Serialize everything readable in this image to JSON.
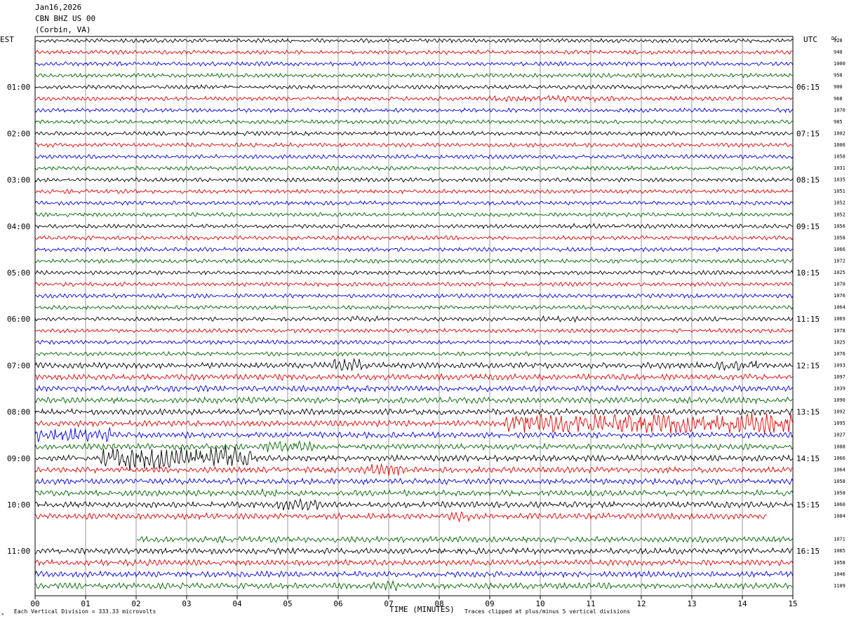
{
  "header": {
    "date": "Jan16,2026",
    "station": "CBN BHZ US 00",
    "location": "(Corbin, VA)"
  },
  "left_timezone": "EST",
  "right_timezone": "UTC",
  "dc_label": "DC",
  "footer": {
    "scale_note": "Each Vertical Division =  333.33 microvolts",
    "xlabel": "TIME (MINUTES)",
    "clip_note": "Traces clipped at plus/minus 5 vertical divisions"
  },
  "colors": {
    "traces": [
      "#000000",
      "#e00000",
      "#0000e0",
      "#006400"
    ],
    "grid": "#808080"
  },
  "chart_data": {
    "type": "line",
    "title": "Jan16,2026 CBN BHZ US 00 (Corbin, VA)",
    "xlabel": "TIME (MINUTES)",
    "xlim": [
      0,
      15
    ],
    "x_ticks": [
      "00",
      "01",
      "02",
      "03",
      "04",
      "05",
      "06",
      "07",
      "08",
      "09",
      "10",
      "11",
      "12",
      "13",
      "14",
      "15"
    ],
    "grid": true,
    "trace_count": 48,
    "left_times": [
      "01:00",
      "02:00",
      "03:00",
      "04:00",
      "05:00",
      "06:00",
      "07:00",
      "08:00",
      "09:00",
      "10:00",
      "11:00"
    ],
    "right_times": [
      "06:15",
      "07:15",
      "08:15",
      "09:15",
      "10:15",
      "11:15",
      "12:15",
      "13:15",
      "14:15",
      "15:15",
      "16:15"
    ],
    "time_label_rows": [
      4,
      8,
      12,
      16,
      20,
      24,
      28,
      32,
      36,
      40,
      44
    ],
    "dc_offsets": [
      "928",
      "940",
      "1000",
      "958",
      "900",
      "968",
      "1070",
      "985",
      "1002",
      "1006",
      "1058",
      "1031",
      "1035",
      "1051",
      "1052",
      "1052",
      "1056",
      "1058",
      "1066",
      "1072",
      "1025",
      "1070",
      "1076",
      "1064",
      "1069",
      "1078",
      "1025",
      "1076",
      "1093",
      "1097",
      "1039",
      "1090",
      "1092",
      "1095",
      "1027",
      "1088",
      "1066",
      "1064",
      "1058",
      "1058",
      "1060",
      "1084",
      "",
      "1071",
      "1085",
      "1058",
      "1046",
      "1109"
    ],
    "events": [
      {
        "row": 5,
        "start_min": 9.0,
        "end_min": 11.5,
        "amplitude": 1.5
      },
      {
        "row": 16,
        "start_min": 10.5,
        "end_min": 11.2,
        "amplitude": 1.5
      },
      {
        "row": 24,
        "start_min": 6.2,
        "end_min": 6.8,
        "amplitude": 1.5
      },
      {
        "row": 24,
        "start_min": 10.0,
        "end_min": 10.8,
        "amplitude": 1.4
      },
      {
        "row": 28,
        "start_min": 5.9,
        "end_min": 6.6,
        "amplitude": 2.3
      },
      {
        "row": 28,
        "start_min": 13.5,
        "end_min": 14.3,
        "amplitude": 1.8
      },
      {
        "row": 33,
        "start_min": 9.3,
        "end_min": 15.0,
        "amplitude": 3.5
      },
      {
        "row": 34,
        "start_min": 0.0,
        "end_min": 1.5,
        "amplitude": 2.5
      },
      {
        "row": 35,
        "start_min": 4.5,
        "end_min": 5.5,
        "amplitude": 2.0
      },
      {
        "row": 36,
        "start_min": 1.3,
        "end_min": 4.3,
        "amplitude": 4.0
      },
      {
        "row": 37,
        "start_min": 6.5,
        "end_min": 7.3,
        "amplitude": 2.0
      },
      {
        "row": 39,
        "start_min": 4.5,
        "end_min": 4.8,
        "amplitude": 2.0
      },
      {
        "row": 40,
        "start_min": 4.7,
        "end_min": 5.6,
        "amplitude": 2.0
      },
      {
        "row": 41,
        "start_min": 8.2,
        "end_min": 8.6,
        "amplitude": 1.8
      },
      {
        "row": 47,
        "start_min": 6.7,
        "end_min": 7.2,
        "amplitude": 1.8
      }
    ],
    "gaps": [
      {
        "row": 41,
        "start_min": 14.5,
        "end_min": 15.0
      },
      {
        "row": 42,
        "start_min": 0.0,
        "end_min": 15.0
      },
      {
        "row": 43,
        "start_min": 0.0,
        "end_min": 2.0
      }
    ]
  }
}
